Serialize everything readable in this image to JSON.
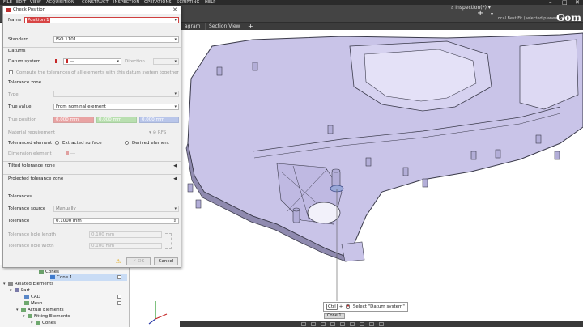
{
  "menubar": {
    "items": [
      "FILE",
      "EDIT",
      "VIEW",
      "ACQUISITION",
      "CONSTRUCT",
      "INSPECTION",
      "OPERATIONS",
      "SCRIPTING",
      "HELP"
    ]
  },
  "toolbar": {
    "workspace": "Inspection(*)",
    "alignment": "Local Best Fit (selected planes) - Part",
    "logo": "Gom"
  },
  "tabs": {
    "items": [
      "agram",
      "Section View"
    ],
    "add": "+"
  },
  "dialog": {
    "title": "Check Position",
    "close": "✕",
    "name_label": "Name",
    "name_value": "Position 1",
    "standard_label": "Standard",
    "standard_value": "ISO 1101",
    "datums_header": "Datums",
    "datum_system_label": "Datum system",
    "datum_system_value": "---",
    "direction_label": "Direction",
    "compute_all_label": "Compute the tolerances of all elements with this datum system together",
    "tolerance_zone_header": "Tolerance zone",
    "type_label": "Type",
    "true_value_label": "True value",
    "true_value_value": "From nominal element",
    "true_position_label": "True position",
    "true_position_x": "0.000 mm",
    "true_position_y": "0.000 mm",
    "true_position_z": "0.000 mm",
    "material_req_label": "Material requirement",
    "rfs_label": "RFS",
    "toleranced_element_label": "Toleranced element",
    "extracted_surface_label": "Extracted surface",
    "derived_element_label": "Derived element",
    "dimension_element_label": "Dimension element",
    "dimension_element_value": "---",
    "tilted_zone_header": "Tilted tolerance zone",
    "projected_zone_header": "Projected tolerance zone",
    "tolerances_header": "Tolerances",
    "tolerance_source_label": "Tolerance source",
    "tolerance_source_value": "Manually",
    "tolerance_label": "Tolerance",
    "tolerance_value": "0.1000 mm",
    "hole_length_label": "Tolerance hole length",
    "hole_length_value": "0.100 mm",
    "hole_width_label": "Tolerance hole width",
    "hole_width_value": "0.100 mm",
    "ok_label": "OK",
    "cancel_label": "Cancel",
    "warning_icon": "⚠"
  },
  "explorer": {
    "rows": [
      {
        "label": "Cones",
        "indent": 0
      },
      {
        "label": "Cone 1",
        "indent": 1
      },
      {
        "label": "Related Elements",
        "indent": 0
      },
      {
        "label": "Part",
        "indent": 1
      },
      {
        "label": "CAD",
        "indent": 2
      },
      {
        "label": "Mesh",
        "indent": 2
      },
      {
        "label": "Actual Elements",
        "indent": 2
      },
      {
        "label": "Fitting Elements",
        "indent": 3
      },
      {
        "label": "Cones",
        "indent": 4
      }
    ]
  },
  "hint": {
    "key": "Ctrl",
    "plus": "+",
    "text": "Select \"Datum system\"",
    "cone_tag": "Cone 1"
  },
  "colors": {
    "part_fill": "#c9c4e8",
    "part_edge": "#3a3a4a",
    "accent_red": "#c62828",
    "dark_chrome": "#3c3c3c"
  }
}
